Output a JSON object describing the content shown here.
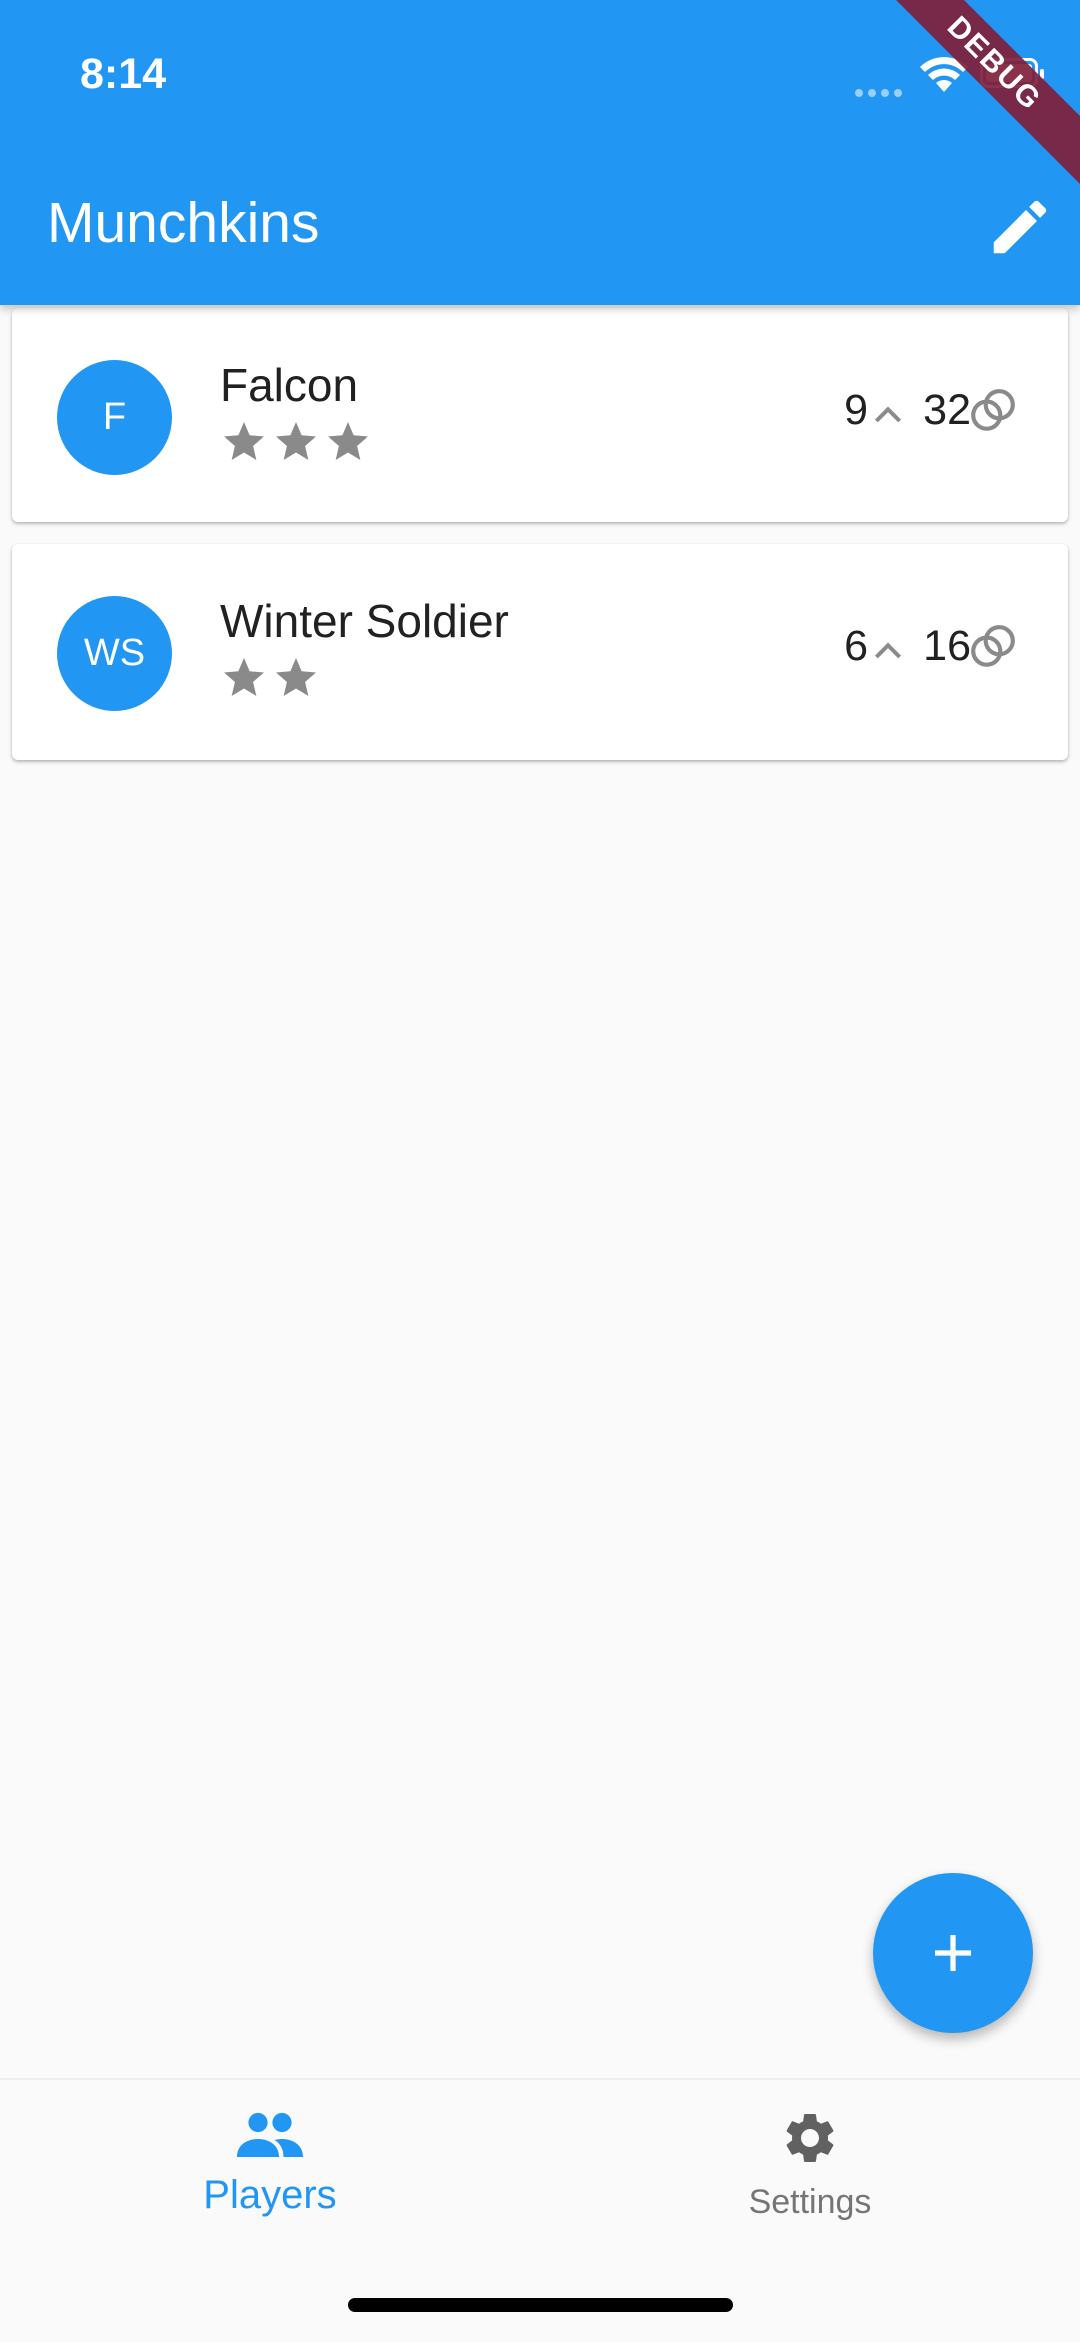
{
  "status_bar": {
    "time": "8:14"
  },
  "app_bar": {
    "title": "Munchkins",
    "debug_label": "DEBUG"
  },
  "players": [
    {
      "initials": "F",
      "name": "Falcon",
      "stars": 3,
      "level": "9",
      "gold": "32"
    },
    {
      "initials": "WS",
      "name": "Winter Soldier",
      "stars": 2,
      "level": "6",
      "gold": "16"
    }
  ],
  "bottom_nav": {
    "items": [
      {
        "label": "Players",
        "icon": "people-icon",
        "active": true
      },
      {
        "label": "Settings",
        "icon": "gear-icon",
        "active": false
      }
    ]
  },
  "colors": {
    "primary": "#2196f3",
    "star": "#8a8a8a",
    "debug": "#80203c"
  }
}
